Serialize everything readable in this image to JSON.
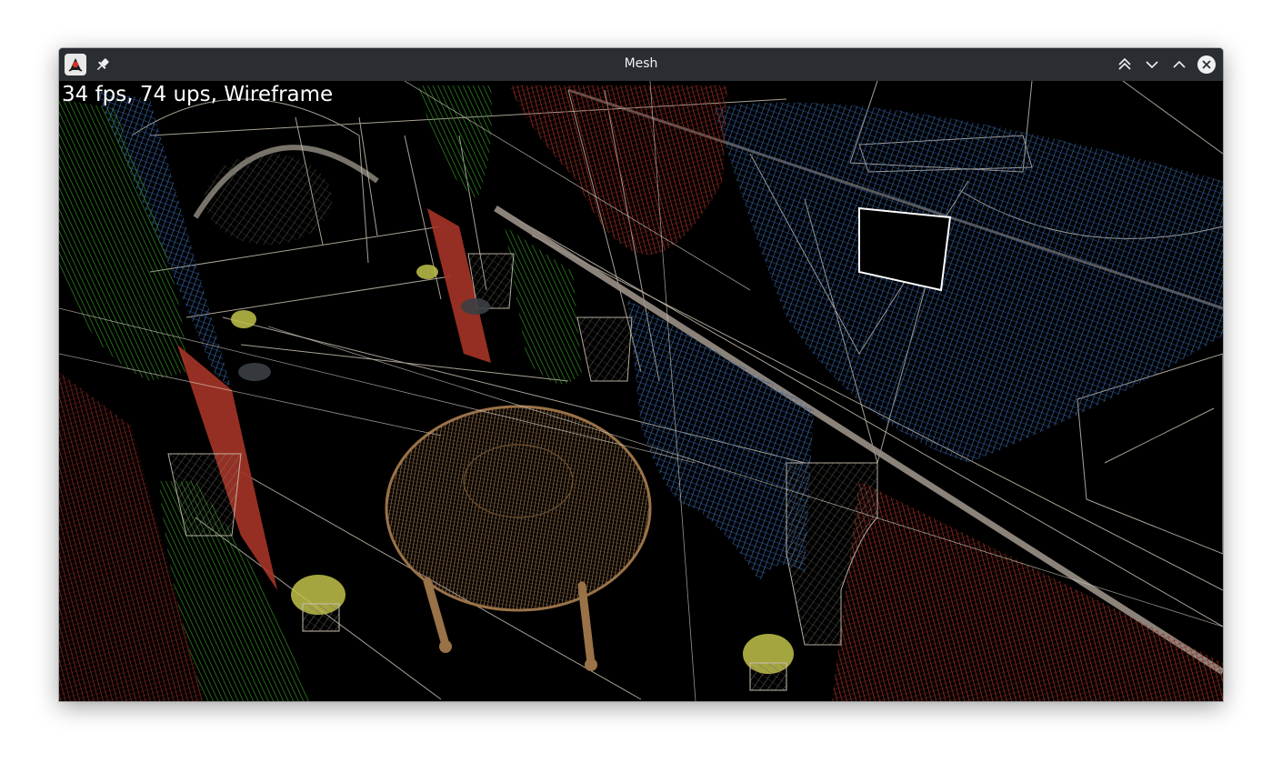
{
  "window": {
    "title": "Mesh",
    "app_icon": "java-duke-icon",
    "pin_icon": "pin-icon",
    "buttons": {
      "keep_above_icon": "double-chevron-up-icon",
      "minimize_icon": "chevron-down-icon",
      "maximize_icon": "chevron-up-icon",
      "close_icon": "close-circle-icon"
    }
  },
  "viewport": {
    "overlay_text": "34 fps, 74 ups, Wireframe",
    "render_mode": "Wireframe",
    "colors": {
      "background": "#000000",
      "structure": "#c8bfb0",
      "curtain_blue": "#3e6fb5",
      "curtain_red": "#a63427",
      "curtain_green": "#2f8a22",
      "table": "#9a7248",
      "plant": "#c2c24a"
    }
  }
}
